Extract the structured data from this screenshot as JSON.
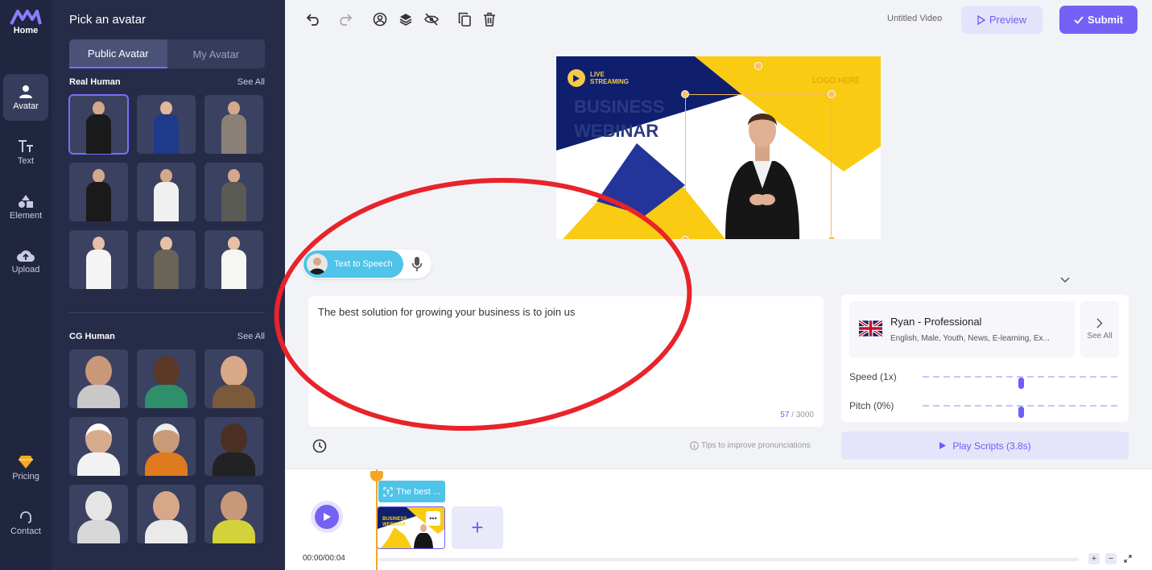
{
  "rail": {
    "home": "Home",
    "items": [
      {
        "label": "Avatar",
        "icon": "person-icon"
      },
      {
        "label": "Text",
        "icon": "text-icon"
      },
      {
        "label": "Element",
        "icon": "shapes-icon"
      },
      {
        "label": "Upload",
        "icon": "cloud-upload-icon"
      }
    ],
    "pricing": "Pricing",
    "contact": "Contact"
  },
  "panel": {
    "title": "Pick an avatar",
    "tabs": [
      "Public Avatar",
      "My Avatar"
    ],
    "real_human": {
      "title": "Real Human",
      "see_all": "See All"
    },
    "cg_human": {
      "title": "CG Human",
      "see_all": "See All"
    }
  },
  "topbar": {
    "doc_title": "Untitled Video",
    "preview": "Preview",
    "submit": "Submit"
  },
  "canvas": {
    "live1": "LIVE",
    "live2": "STREAMING",
    "headline1": "BUSINESS",
    "headline2": "WEBINAR",
    "logo": "LOGO HERE"
  },
  "tts": {
    "label": "Text to Speech",
    "script": "The best solution for growing your business is to join us",
    "count": "57",
    "max": "/ 3000",
    "tips": "Tips to improve pronunciations"
  },
  "voice": {
    "name": "Ryan - Professional",
    "tags": "English, Male, Youth, News, E-learning, Ex...",
    "see_all": "See All",
    "speed_label": "Speed (1x)",
    "pitch_label": "Pitch (0%)",
    "speed_level": 0.5,
    "pitch_level": 0.5,
    "play": "Play Scripts (3.8s)"
  },
  "timeline": {
    "time": "00:00/00:04",
    "clip_label": "The best ...",
    "clip_title1": "BUSINESS",
    "clip_title2": "WEBINAR"
  },
  "colors": {
    "accent": "#7461f5",
    "tts": "#4fc3e8",
    "annotation": "#e8232a"
  }
}
